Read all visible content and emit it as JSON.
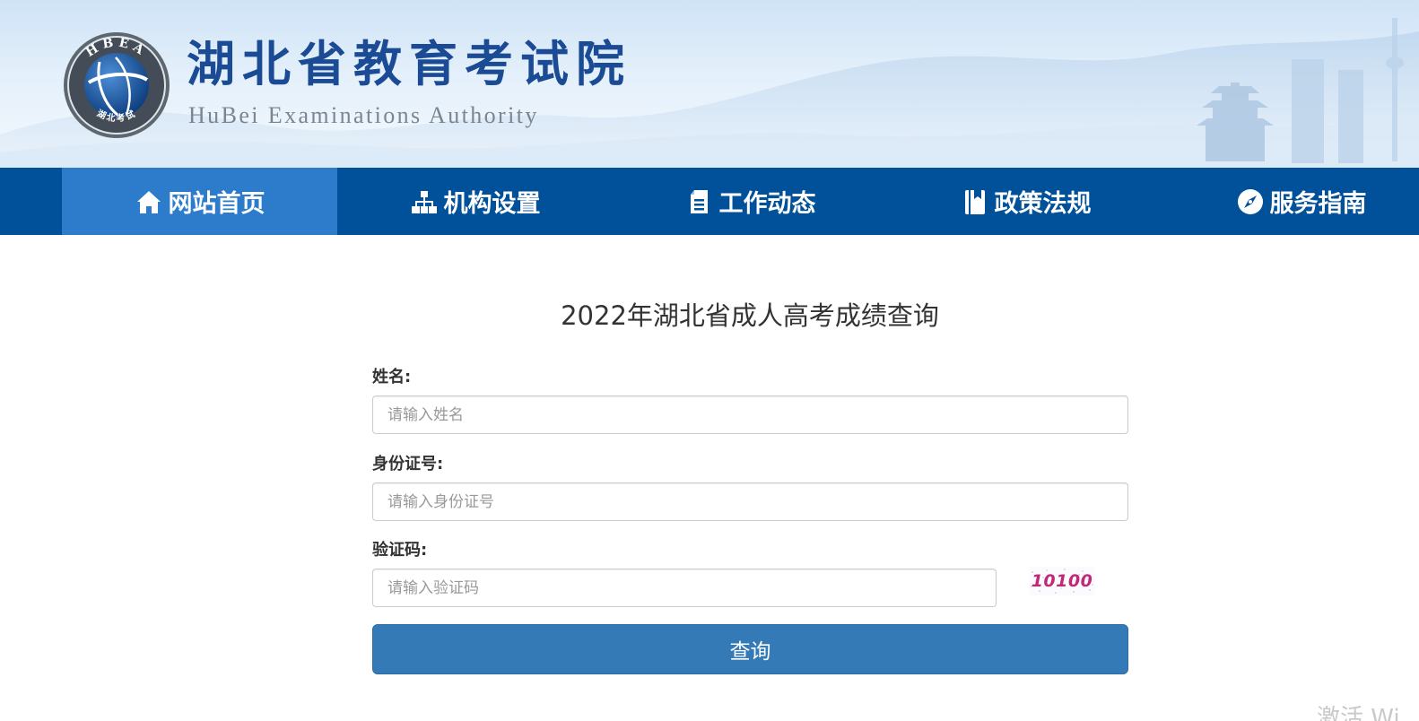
{
  "header": {
    "site_name": "湖北省教育考试院",
    "site_name_en": "HuBei Examinations Authority",
    "emblem_top_text": "HBEA",
    "emblem_bottom_text": "湖北考试"
  },
  "nav": {
    "items": [
      {
        "label": "网站首页",
        "icon": "home-icon",
        "active": true
      },
      {
        "label": "机构设置",
        "icon": "org-chart-icon",
        "active": false
      },
      {
        "label": "工作动态",
        "icon": "document-icon",
        "active": false
      },
      {
        "label": "政策法规",
        "icon": "book-icon",
        "active": false
      },
      {
        "label": "服务指南",
        "icon": "compass-icon",
        "active": false
      }
    ]
  },
  "form": {
    "title": "2022年湖北省成人高考成绩查询",
    "name_label": "姓名:",
    "name_placeholder": "请输入姓名",
    "id_label": "身份证号:",
    "id_placeholder": "请输入身份证号",
    "captcha_label": "验证码:",
    "captcha_placeholder": "请输入验证码",
    "captcha_value": "10100",
    "submit_label": "查询"
  },
  "watermark": "激活 Wi",
  "colors": {
    "nav_bg": "#005199",
    "nav_active": "#2c7ccb",
    "button_bg": "#337ab7",
    "brand_blue": "#1a4b94"
  }
}
